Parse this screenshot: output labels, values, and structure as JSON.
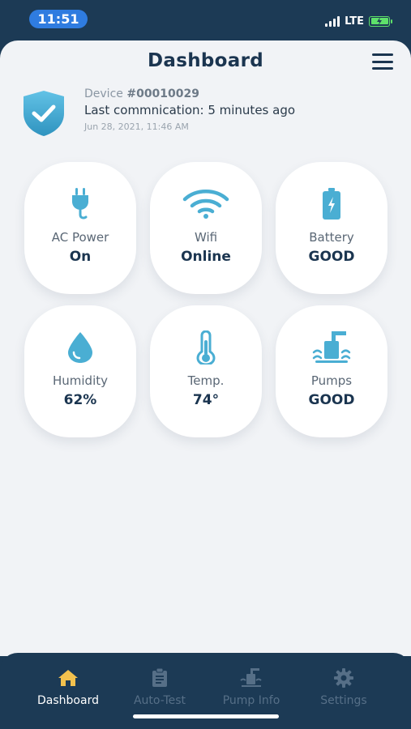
{
  "status_bar": {
    "time": "11:51",
    "network": "LTE",
    "battery_icon": "charging-battery-icon"
  },
  "header": {
    "title": "Dashboard",
    "menu_icon": "hamburger-menu-icon"
  },
  "device": {
    "label": "Device",
    "id": "#00010029",
    "last_communication": "Last commnication: 5 minutes ago",
    "timestamp": "Jun 28, 2021, 11:46 AM",
    "shield_icon": "shield-check-icon"
  },
  "tiles": [
    {
      "icon": "plug-icon",
      "label": "AC Power",
      "value": "On"
    },
    {
      "icon": "wifi-icon",
      "label": "Wifi",
      "value": "Online"
    },
    {
      "icon": "battery-icon",
      "label": "Battery",
      "value": "GOOD"
    },
    {
      "icon": "water-drop-icon",
      "label": "Humidity",
      "value": "62%"
    },
    {
      "icon": "thermometer-icon",
      "label": "Temp.",
      "value": "74°"
    },
    {
      "icon": "pump-icon",
      "label": "Pumps",
      "value": "GOOD"
    }
  ],
  "nav": {
    "items": [
      {
        "icon": "home-icon",
        "label": "Dashboard",
        "active": true
      },
      {
        "icon": "clipboard-icon",
        "label": "Auto-Test",
        "active": false
      },
      {
        "icon": "pump-icon",
        "label": "Pump Info",
        "active": false
      },
      {
        "icon": "gear-icon",
        "label": "Settings",
        "active": false
      }
    ]
  },
  "colors": {
    "accent": "#4aaed3",
    "navy": "#1c3a55",
    "active_nav_icon": "#f2c14e"
  }
}
